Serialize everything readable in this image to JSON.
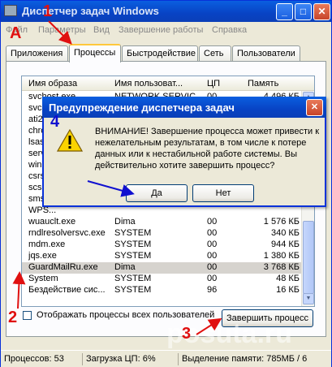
{
  "window": {
    "title": "Диспетчер задач Windows",
    "minimize_glyph": "_",
    "maximize_glyph": "□",
    "close_glyph": "✕",
    "icon": "task-manager-icon"
  },
  "menu": [
    "Файл",
    "Параметры",
    "Вид",
    "Завершение работы",
    "Справка"
  ],
  "tabs": [
    "Приложения",
    "Процессы",
    "Быстродействие",
    "Сеть",
    "Пользователи"
  ],
  "active_tab": "Процессы",
  "columns": [
    "Имя образа",
    "Имя пользоват...",
    "ЦП",
    "Память"
  ],
  "processes": [
    {
      "name": "svchost.exe",
      "user": "NETWORK SERVICE",
      "cpu": "00",
      "mem": "4 496 КБ"
    },
    {
      "name": "svchost.exe",
      "user": "",
      "cpu": "",
      "mem": ""
    },
    {
      "name": "ati2evxx.exe",
      "user": "",
      "cpu": "",
      "mem": ""
    },
    {
      "name": "chrome.exe",
      "user": "",
      "cpu": "",
      "mem": ""
    },
    {
      "name": "lsass.exe",
      "user": "",
      "cpu": "",
      "mem": ""
    },
    {
      "name": "services.exe",
      "user": "",
      "cpu": "",
      "mem": ""
    },
    {
      "name": "winlogon.exe",
      "user": "",
      "cpu": "",
      "mem": ""
    },
    {
      "name": "csrss.exe",
      "user": "",
      "cpu": "",
      "mem": ""
    },
    {
      "name": "scsiaccess.exe",
      "user": "",
      "cpu": "",
      "mem": ""
    },
    {
      "name": "smss.exe",
      "user": "",
      "cpu": "",
      "mem": ""
    },
    {
      "name": "WPS...",
      "user": "",
      "cpu": "",
      "mem": ""
    },
    {
      "name": "wuauclt.exe",
      "user": "Dima",
      "cpu": "00",
      "mem": "1 576 КБ"
    },
    {
      "name": "rndlresolversvc.exe",
      "user": "SYSTEM",
      "cpu": "00",
      "mem": "340 КБ"
    },
    {
      "name": "mdm.exe",
      "user": "SYSTEM",
      "cpu": "00",
      "mem": "944 КБ"
    },
    {
      "name": "jqs.exe",
      "user": "SYSTEM",
      "cpu": "00",
      "mem": "1 380 КБ"
    },
    {
      "name": "GuardMailRu.exe",
      "user": "Dima",
      "cpu": "00",
      "mem": "3 768 КБ"
    },
    {
      "name": "System",
      "user": "SYSTEM",
      "cpu": "00",
      "mem": "48 КБ"
    },
    {
      "name": "Бездействие сис...",
      "user": "SYSTEM",
      "cpu": "96",
      "mem": "16 КБ"
    }
  ],
  "selected_process_index": 15,
  "show_all_users_label": "Отображать процессы всех пользователей",
  "end_process_label": "Завершить процесс",
  "status": {
    "processes": "Процессов: 53",
    "cpu": "Загрузка ЦП: 6%",
    "memory": "Выделение памяти: 785МБ / 6"
  },
  "dialog": {
    "title": "Предупреждение диспетчера задач",
    "message": "ВНИМАНИЕ! Завершение процесса может привести к нежелательным результатам, в том числе к потере данных или к нестабильной работе системы. Вы действительно хотите завершить процесс?",
    "yes_label": "Да",
    "no_label": "Нет",
    "icon": "warning-icon"
  },
  "annotations": {
    "a": "A",
    "n1": "1",
    "n2": "2",
    "n3": "3",
    "n4": "4",
    "red": "#e01010",
    "blue": "#1010d0"
  },
  "watermark": "posuta.ru"
}
